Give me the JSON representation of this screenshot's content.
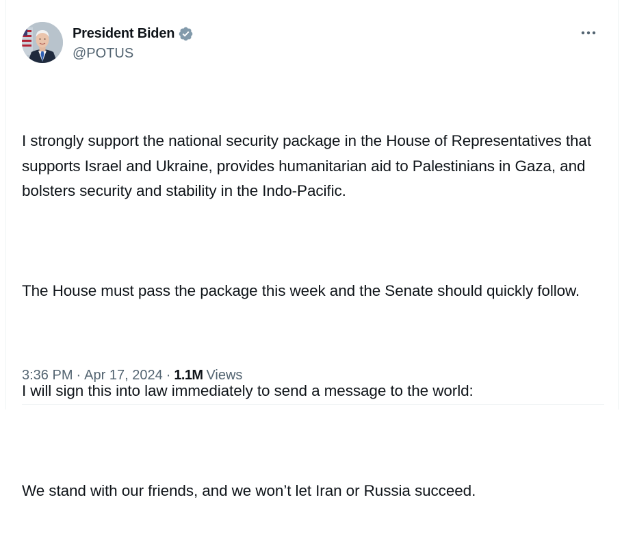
{
  "author": {
    "display_name": "President Biden",
    "handle": "@POTUS",
    "avatar_icon": "presidential-portrait-avatar",
    "verified_icon": "verified-badge-icon",
    "verified_color": "#829aab"
  },
  "menu": {
    "more_icon": "more-options-icon"
  },
  "tweet": {
    "paragraphs": [
      "I strongly support the national security package in the House of Representatives that supports Israel and Ukraine, provides humanitarian aid to Palestinians in Gaza, and bolsters security and stability in the Indo-Pacific.",
      "The House must pass the package this week and the Senate should quickly follow.",
      "I will sign this into law immediately to send a message to the world:",
      "We stand with our friends, and we won’t let Iran or Russia succeed."
    ]
  },
  "meta": {
    "time": "3:36 PM",
    "separator": "·",
    "date": "Apr 17, 2024",
    "views_count": "1.1M",
    "views_label": "Views"
  },
  "colors": {
    "text_primary": "#0f1419",
    "text_secondary": "#536471",
    "divider": "#eff3f4"
  }
}
